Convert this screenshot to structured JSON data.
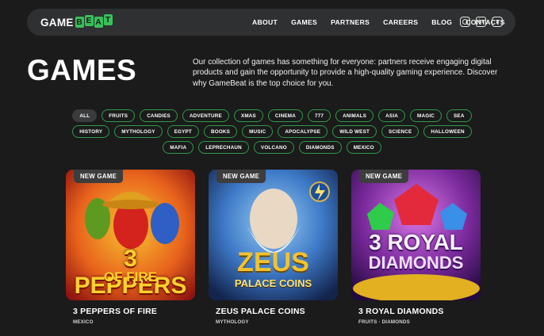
{
  "logo": {
    "game": "GAME",
    "beat": [
      "B",
      "E",
      "A",
      "T"
    ]
  },
  "nav": {
    "items": [
      "ABOUT",
      "GAMES",
      "PARTNERS",
      "CAREERS",
      "BLOG",
      "CONTACTS"
    ]
  },
  "social": [
    {
      "name": "instagram-icon"
    },
    {
      "name": "linkedin-icon",
      "glyph": "in"
    },
    {
      "name": "youtube-icon"
    }
  ],
  "hero": {
    "title": "GAMES",
    "intro": "Our collection of games has something for everyone: partners receive engaging digital products and gain the opportunity to provide a high-quality gaming experience. Discover why GameBeat is the top choice for you."
  },
  "filters": {
    "active": "ALL",
    "items": [
      "ALL",
      "FRUITS",
      "CANDIES",
      "ADVENTURE",
      "XMAS",
      "CINEMA",
      "777",
      "ANIMALS",
      "ASIA",
      "MAGIC",
      "SEA",
      "HISTORY",
      "MYTHOLOGY",
      "EGYPT",
      "BOOKS",
      "MUSIC",
      "APOCALYPSE",
      "WILD WEST",
      "SCIENCE",
      "HALLOWEEN",
      "MAFIA",
      "LEPRECHAUN",
      "VOLCANO",
      "DIAMONDS",
      "MEXICO"
    ]
  },
  "games": [
    {
      "badge": "NEW GAME",
      "title": "3 PEPPERS OF FIRE",
      "tags": "MEXICO",
      "art": [
        "3 PEPPERS",
        "OF FIRE"
      ],
      "colors": [
        "#f2a21b",
        "#c8231a"
      ]
    },
    {
      "badge": "NEW GAME",
      "title": "ZEUS PALACE COINS",
      "tags": "MYTHOLOGY",
      "art": [
        "ZEUS",
        "PALACE COINS"
      ],
      "colors": [
        "#5aa9e8",
        "#1f3b7a"
      ]
    },
    {
      "badge": "NEW GAME",
      "title": "3 ROYAL DIAMONDS",
      "tags": "FRUITS · DIAMONDS",
      "art": [
        "3 ROYAL",
        "DIAMONDS"
      ],
      "colors": [
        "#b73ec9",
        "#3b1766"
      ]
    }
  ]
}
